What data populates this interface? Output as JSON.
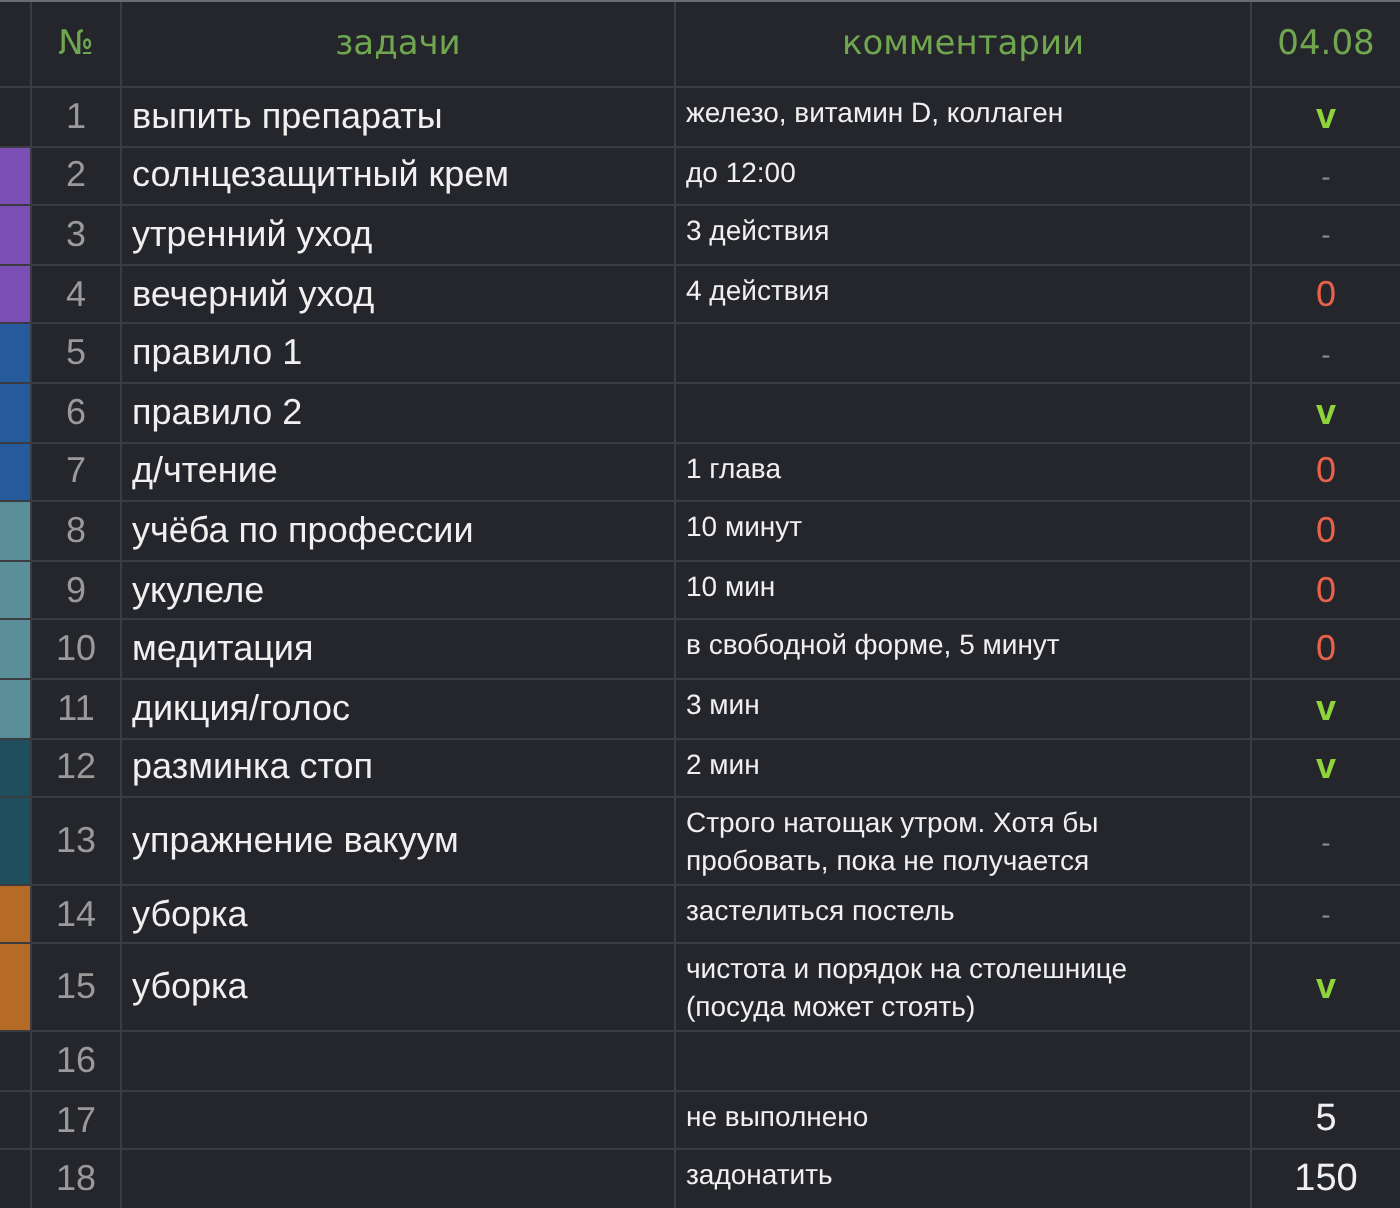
{
  "table": {
    "columns": [
      "№",
      "задачи",
      "комментарии",
      "04.08"
    ],
    "rows": [
      {
        "number": "1",
        "task": "выпить препараты",
        "comment": "железо, витамин D, коллаген",
        "mark": {
          "kind": "done",
          "text": "v"
        }
      },
      {
        "number": "2",
        "task": "солнцезащитный крем",
        "comment": "до 12:00",
        "color": "#7b4fb5",
        "mark": {
          "kind": "skipped",
          "text": "-"
        }
      },
      {
        "number": "3",
        "task": "утренний уход",
        "comment": "3 действия",
        "color": "#7b4fb5",
        "mark": {
          "kind": "skipped",
          "text": "-"
        }
      },
      {
        "number": "4",
        "task": "вечерний уход",
        "comment": "4 действия",
        "color": "#7b4fb5",
        "mark": {
          "kind": "missed",
          "text": "0"
        }
      },
      {
        "number": "5",
        "task": "правило 1",
        "color": "#255a9c",
        "mark": {
          "kind": "skipped",
          "text": "-"
        }
      },
      {
        "number": "6",
        "task": "правило 2",
        "color": "#255a9c",
        "mark": {
          "kind": "done",
          "text": "v"
        }
      },
      {
        "number": "7",
        "task": "д/чтение",
        "comment": "1 глава",
        "color": "#255a9c",
        "mark": {
          "kind": "missed",
          "text": "0"
        }
      },
      {
        "number": "8",
        "task": "учёба по профессии",
        "comment": "10 минут",
        "color": "#5a8f9a",
        "mark": {
          "kind": "missed",
          "text": "0"
        }
      },
      {
        "number": "9",
        "task": "укулеле",
        "comment": "10 мин",
        "color": "#5a8f9a",
        "mark": {
          "kind": "missed",
          "text": "0"
        }
      },
      {
        "number": "10",
        "task": "медитация",
        "comment": "в свободной форме, 5 минут",
        "color": "#5a8f9a",
        "mark": {
          "kind": "missed",
          "text": "0"
        }
      },
      {
        "number": "11",
        "task": "дикция/голос",
        "comment": "3 мин",
        "color": "#5a8f9a",
        "mark": {
          "kind": "done",
          "text": "v"
        }
      },
      {
        "number": "12",
        "task": "разминка стоп",
        "comment": "2 мин",
        "color": "#1f4f5c",
        "mark": {
          "kind": "done",
          "text": "v"
        }
      },
      {
        "number": "13",
        "task": "упражнение вакуум",
        "comment": "Строго натощак утром. Хотя бы пробовать, пока не получается",
        "color": "#1f4f5c",
        "mark": {
          "kind": "skipped",
          "text": "-"
        }
      },
      {
        "number": "14",
        "task": "уборка",
        "comment": "застелиться постель",
        "color": "#b56a25",
        "mark": {
          "kind": "skipped",
          "text": "-"
        }
      },
      {
        "number": "15",
        "task": "уборка",
        "comment": "чистота и порядок на столешнице (посуда может стоять)",
        "color": "#b56a25",
        "mark": {
          "kind": "done",
          "text": "v"
        }
      },
      {
        "number": "16"
      },
      {
        "number": "17",
        "comment": "не выполнено",
        "mark": {
          "kind": "number",
          "text": "5"
        }
      },
      {
        "number": "18",
        "comment": "задонатить",
        "mark": {
          "kind": "number",
          "text": "150"
        }
      }
    ]
  }
}
